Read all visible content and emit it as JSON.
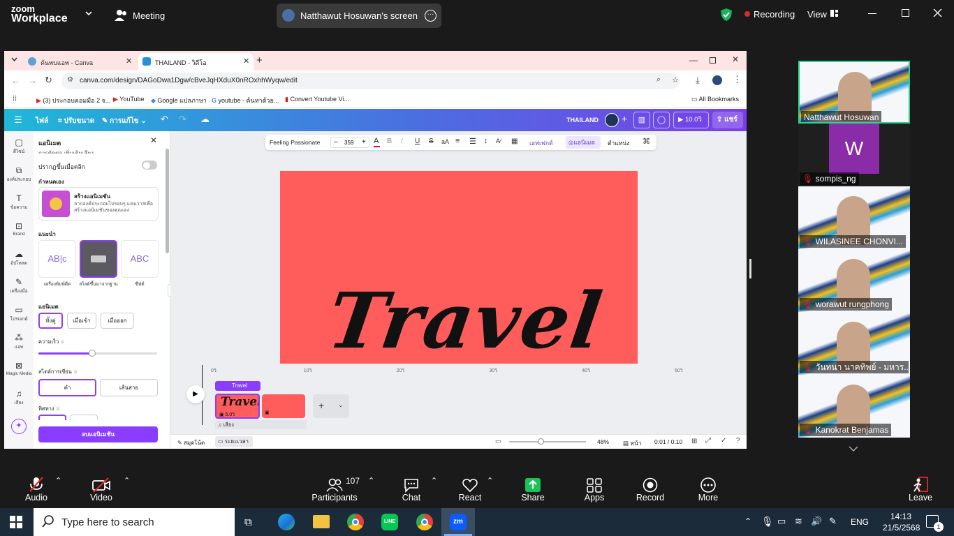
{
  "zoom": {
    "brand_line1": "zoom",
    "brand_line2": "Workplace",
    "meeting_label": "Meeting",
    "screen_share_title": "Natthawut Hosuwan's screen",
    "recording_label": "Recording",
    "view_label": "View",
    "toolbar": {
      "audio": "Audio",
      "video": "Video",
      "participants": "Participants",
      "participants_count": "107",
      "chat": "Chat",
      "react": "React",
      "share": "Share",
      "apps": "Apps",
      "record": "Record",
      "more": "More",
      "leave": "Leave"
    },
    "colors": {
      "share_green": "#1ac257",
      "record_red": "#e02828",
      "active_border": "#2dd08d"
    }
  },
  "participants": [
    {
      "name": "Natthawut Hosuwan",
      "muted": false,
      "active": true
    },
    {
      "name": "sompis_ng",
      "muted": true,
      "avatar_letter": "W"
    },
    {
      "name": "WILASINEE CHONVI...",
      "muted": true
    },
    {
      "name": "worawut rungphong",
      "muted": true
    },
    {
      "name": "วันทนา นาคทิพย์ - มหาร...",
      "muted": true
    },
    {
      "name": "Kanokrat Benjamas",
      "muted": true
    }
  ],
  "browser": {
    "tabs": [
      {
        "title": "ค้นพบแอพ - Canva",
        "active": false
      },
      {
        "title": "THAILAND - วิดีโอ",
        "active": true
      }
    ],
    "url": "canva.com/design/DAGoDwa1Dgw/cBveJqHXduX0nROxhhWyqw/edit",
    "bookmarks": [
      "(3) ประกอบคอมมือ 2 จ...",
      "YouTube",
      "Google แปลภาษา",
      "youtube - ค้นหาด้วย...",
      "Convert Youtube Vi..."
    ],
    "all_bookmarks": "All Bookmarks"
  },
  "canva": {
    "menu": {
      "file": "ไฟล์",
      "resize": "ปรับขนาด",
      "editing": "การแก้ไข"
    },
    "design_title": "THAILAND",
    "play_time": "10.0วิ",
    "share": "แชร์",
    "sidebar": [
      "ดีไซน์",
      "องค์ประกอบ",
      "ข้อความ",
      "Brand",
      "อัปโหลด",
      "เครื่องมือ",
      "โปรเจกต์",
      "แอพ",
      "Magic Media",
      "เสียง"
    ],
    "toolbar": {
      "font": "Feeling Passionate",
      "size": "359",
      "effects": "เอฟเฟกต์",
      "animate": "แอนิเมต",
      "position": "ตำแหน่ง"
    },
    "panel": {
      "title": "แอนิเมต",
      "cut_heading": "การตัดต่อ เพิ่มเติมเสียง",
      "appear_on_click": "ปรากฏขึ้นเมื่อคลิก",
      "custom_heading": "กำหนดเอง",
      "create_title": "สร้างแอนิเมชัน",
      "create_desc": "ลากองค์ประกอบไปรอบๆ แคนวาสเพื่อสร้างแอนิเมชันของคุณเอง",
      "suggest_heading": "แนะนำ",
      "presets": [
        "เครื่องพิมพ์ดีด",
        "สไลด์ขึ้นมาจากฐาน",
        "ซีฟต์"
      ],
      "anim_heading": "แอนิเมต",
      "anim_buttons": [
        "ทั้งคู่",
        "เมื่อเข้า",
        "เมื่อออก"
      ],
      "speed_label": "ความเร็ว",
      "speed_value": 0.45,
      "style_label": "สไตล์การเขียน",
      "style_buttons": [
        "คำ",
        "เส้นสาย"
      ],
      "direction_label": "ทิศทาง",
      "remove_button": "ลบแอนิเมชัน"
    },
    "canvas_text": "Travel",
    "canvas_bg": "#ff5c5c",
    "timeline": {
      "ticks": [
        "0วิ",
        "10วิ",
        "20วิ",
        "30วิ",
        "40วิ",
        "50วิ"
      ],
      "clip_label": "Travel",
      "clip_duration": "5.0วิ",
      "audio_label": "เสียง"
    },
    "footer": {
      "notes": "สมุดโน้ต",
      "timeline": "ระยะเวลา",
      "zoom": "48%",
      "page": "หน้า",
      "time": "0:01 / 0:10"
    }
  },
  "taskbar": {
    "search_placeholder": "Type here to search",
    "lang": "ENG",
    "time": "14:13",
    "date": "21/5/2568",
    "notifications": "1"
  }
}
